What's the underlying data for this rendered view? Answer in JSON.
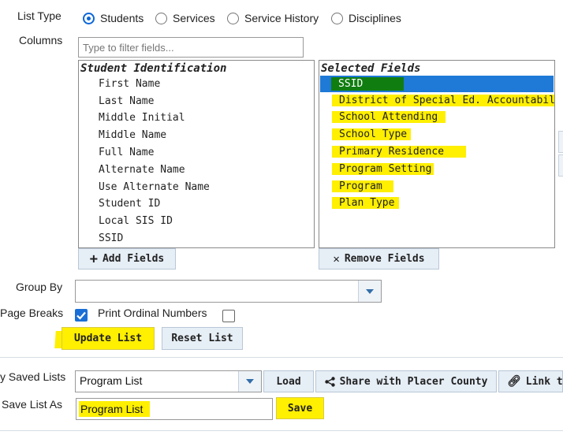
{
  "list_type": {
    "label": "List Type",
    "options": [
      {
        "label": "Students",
        "selected": true
      },
      {
        "label": "Services",
        "selected": false
      },
      {
        "label": "Service History",
        "selected": false
      },
      {
        "label": "Disciplines",
        "selected": false
      }
    ]
  },
  "columns": {
    "label": "Columns",
    "filter_placeholder": "Type to filter fields...",
    "available": {
      "group_header": "Student Identification",
      "items": [
        "First Name",
        "Last Name",
        "Middle Initial",
        "Middle Name",
        "Full Name",
        "Alternate Name",
        "Use Alternate Name",
        "Student ID",
        "Local SIS ID",
        "SSID"
      ]
    },
    "selected": {
      "header": "Selected Fields",
      "items": [
        "SSID",
        "District of Special Ed. Accountability",
        "School Attending",
        "School Type",
        "Primary Residence",
        "Program Setting",
        "Program",
        "Plan Type"
      ]
    },
    "add_label": "Add Fields",
    "remove_label": "Remove Fields"
  },
  "group_by": {
    "label": "Group By",
    "value": ""
  },
  "page_breaks": {
    "label": "Page Breaks",
    "checked": true
  },
  "print_ordinal": {
    "label": "Print Ordinal Numbers",
    "checked": false
  },
  "update_label": "Update List",
  "reset_label": "Reset List",
  "saved_lists": {
    "label": "y Saved Lists",
    "value": "Program List",
    "load_label": "Load",
    "share_label": "Share with Placer County",
    "link_label": "Link to"
  },
  "save_list_as": {
    "label": "Save List As",
    "value": "Program List",
    "save_label": "Save"
  },
  "colors": {
    "accent": "#1a6fd6",
    "selection": "#1e79d7",
    "highlight": "#ffef00",
    "ssid_mark": "#107d10"
  }
}
